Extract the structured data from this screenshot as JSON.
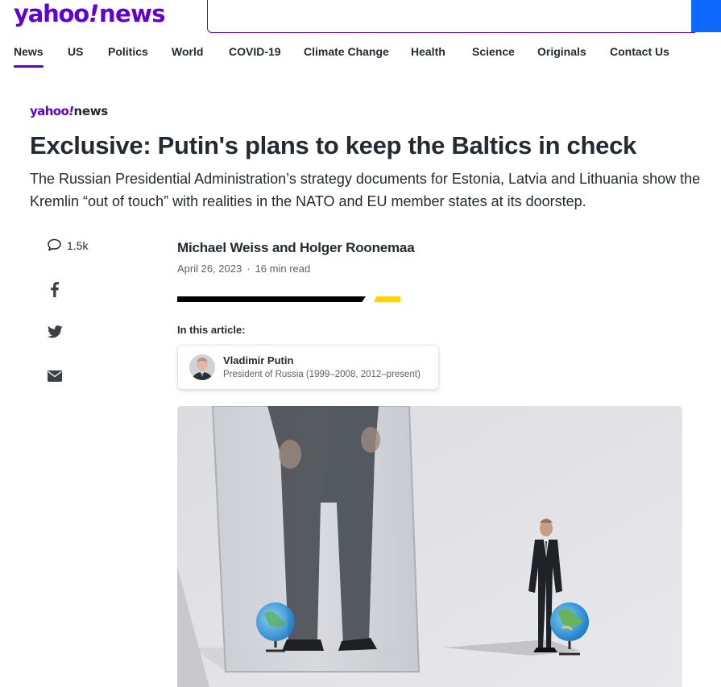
{
  "header": {
    "logo_yahoo": "yahoo",
    "logo_bang": "!",
    "logo_news": "news",
    "search_placeholder": ""
  },
  "nav": {
    "items": [
      {
        "label": "News",
        "active": true
      },
      {
        "label": "US"
      },
      {
        "label": "Politics"
      },
      {
        "label": "World"
      },
      {
        "label": "COVID-19"
      },
      {
        "label": "Climate Change"
      },
      {
        "label": "Health"
      },
      {
        "label": "Science"
      },
      {
        "label": "Originals"
      },
      {
        "label": "Contact Us"
      }
    ]
  },
  "article": {
    "provider_yahoo": "yahoo",
    "provider_bang": "!",
    "provider_news": "news",
    "headline": "Exclusive: Putin's plans to keep the Baltics in check",
    "summary_line1": "The Russian Presidential Administration’s strategy documents for Estonia, Latvia and Lithuania show the",
    "summary_line2": "Kremlin “out of touch” with realities in the NATO and EU member states at its doorstep.",
    "authors": "Michael Weiss and Holger Roonemaa",
    "date": "April 26, 2023",
    "dot": "·",
    "read_time": "16 min read",
    "comments_count": "1.5k",
    "in_this_article_label": "In this article:",
    "entity": {
      "name": "Vladimir Putin",
      "role": "President of Russia (1999–2008, 2012–present)"
    }
  },
  "colors": {
    "brand_purple": "#6001d2",
    "search_blue": "#0f69ff",
    "accent_yellow": "#ffd11a",
    "text_dark": "#232a31",
    "text_muted": "#5b636a"
  },
  "icons": {
    "comment": "comment-icon",
    "facebook": "facebook-icon",
    "twitter": "twitter-icon",
    "email": "email-icon",
    "search": "search-icon"
  }
}
